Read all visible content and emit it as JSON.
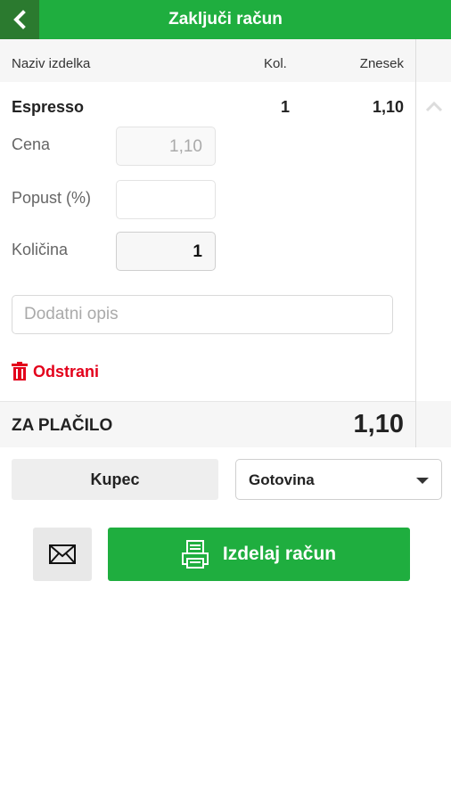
{
  "header": {
    "title": "Zaključi račun"
  },
  "table": {
    "columns": {
      "name": "Naziv izdelka",
      "qty": "Kol.",
      "amount": "Znesek"
    },
    "item": {
      "name": "Espresso",
      "qty": "1",
      "amount": "1,10"
    }
  },
  "fields": {
    "price": {
      "label": "Cena",
      "value": "1,10"
    },
    "discount": {
      "label": "Popust (%)",
      "value": ""
    },
    "quantity": {
      "label": "Količina",
      "value": "1"
    },
    "description_placeholder": "Dodatni opis"
  },
  "actions": {
    "remove_label": "Odstrani"
  },
  "total": {
    "label": "ZA PLAČILO",
    "value": "1,10"
  },
  "customer_button": "Kupec",
  "payment_method": {
    "selected": "Gotovina"
  },
  "issue_button": "Izdelaj račun",
  "icons": {
    "back": "back-chevron-icon",
    "collapse": "chevron-up-icon",
    "remove": "trash-icon",
    "dropdown": "caret-down-icon",
    "email": "envelope-icon",
    "printer": "printer-icon"
  },
  "colors": {
    "accent": "#1fae3f",
    "back_bg": "#2b7a2f",
    "danger": "#e3001b"
  }
}
